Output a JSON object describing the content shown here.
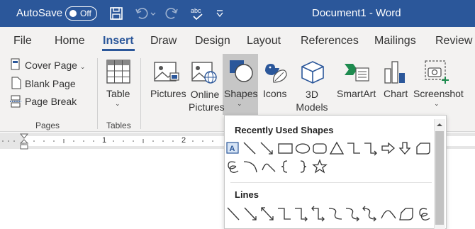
{
  "titlebar": {
    "autosave_label": "AutoSave",
    "toggle_state": "Off",
    "document_title": "Document1 - Word"
  },
  "tabs": [
    "File",
    "Home",
    "Insert",
    "Draw",
    "Design",
    "Layout",
    "References",
    "Mailings",
    "Review"
  ],
  "active_tab": "Insert",
  "ribbon": {
    "pages": {
      "items": [
        "Cover Page",
        "Blank Page",
        "Page Break"
      ],
      "group_label": "Pages"
    },
    "tables": {
      "button": "Table",
      "group_label": "Tables"
    },
    "illustrations": {
      "pictures": "Pictures",
      "online_pictures_line1": "Online",
      "online_pictures_line2": "Pictures",
      "shapes": "Shapes",
      "icons": "Icons",
      "models_line1": "3D",
      "models_line2": "Models",
      "smartart": "SmartArt",
      "chart": "Chart",
      "screenshot": "Screenshot"
    }
  },
  "ruler": {
    "numbers": [
      "1",
      "2"
    ]
  },
  "dropdown": {
    "recent_header": "Recently Used Shapes",
    "lines_header": "Lines"
  }
}
